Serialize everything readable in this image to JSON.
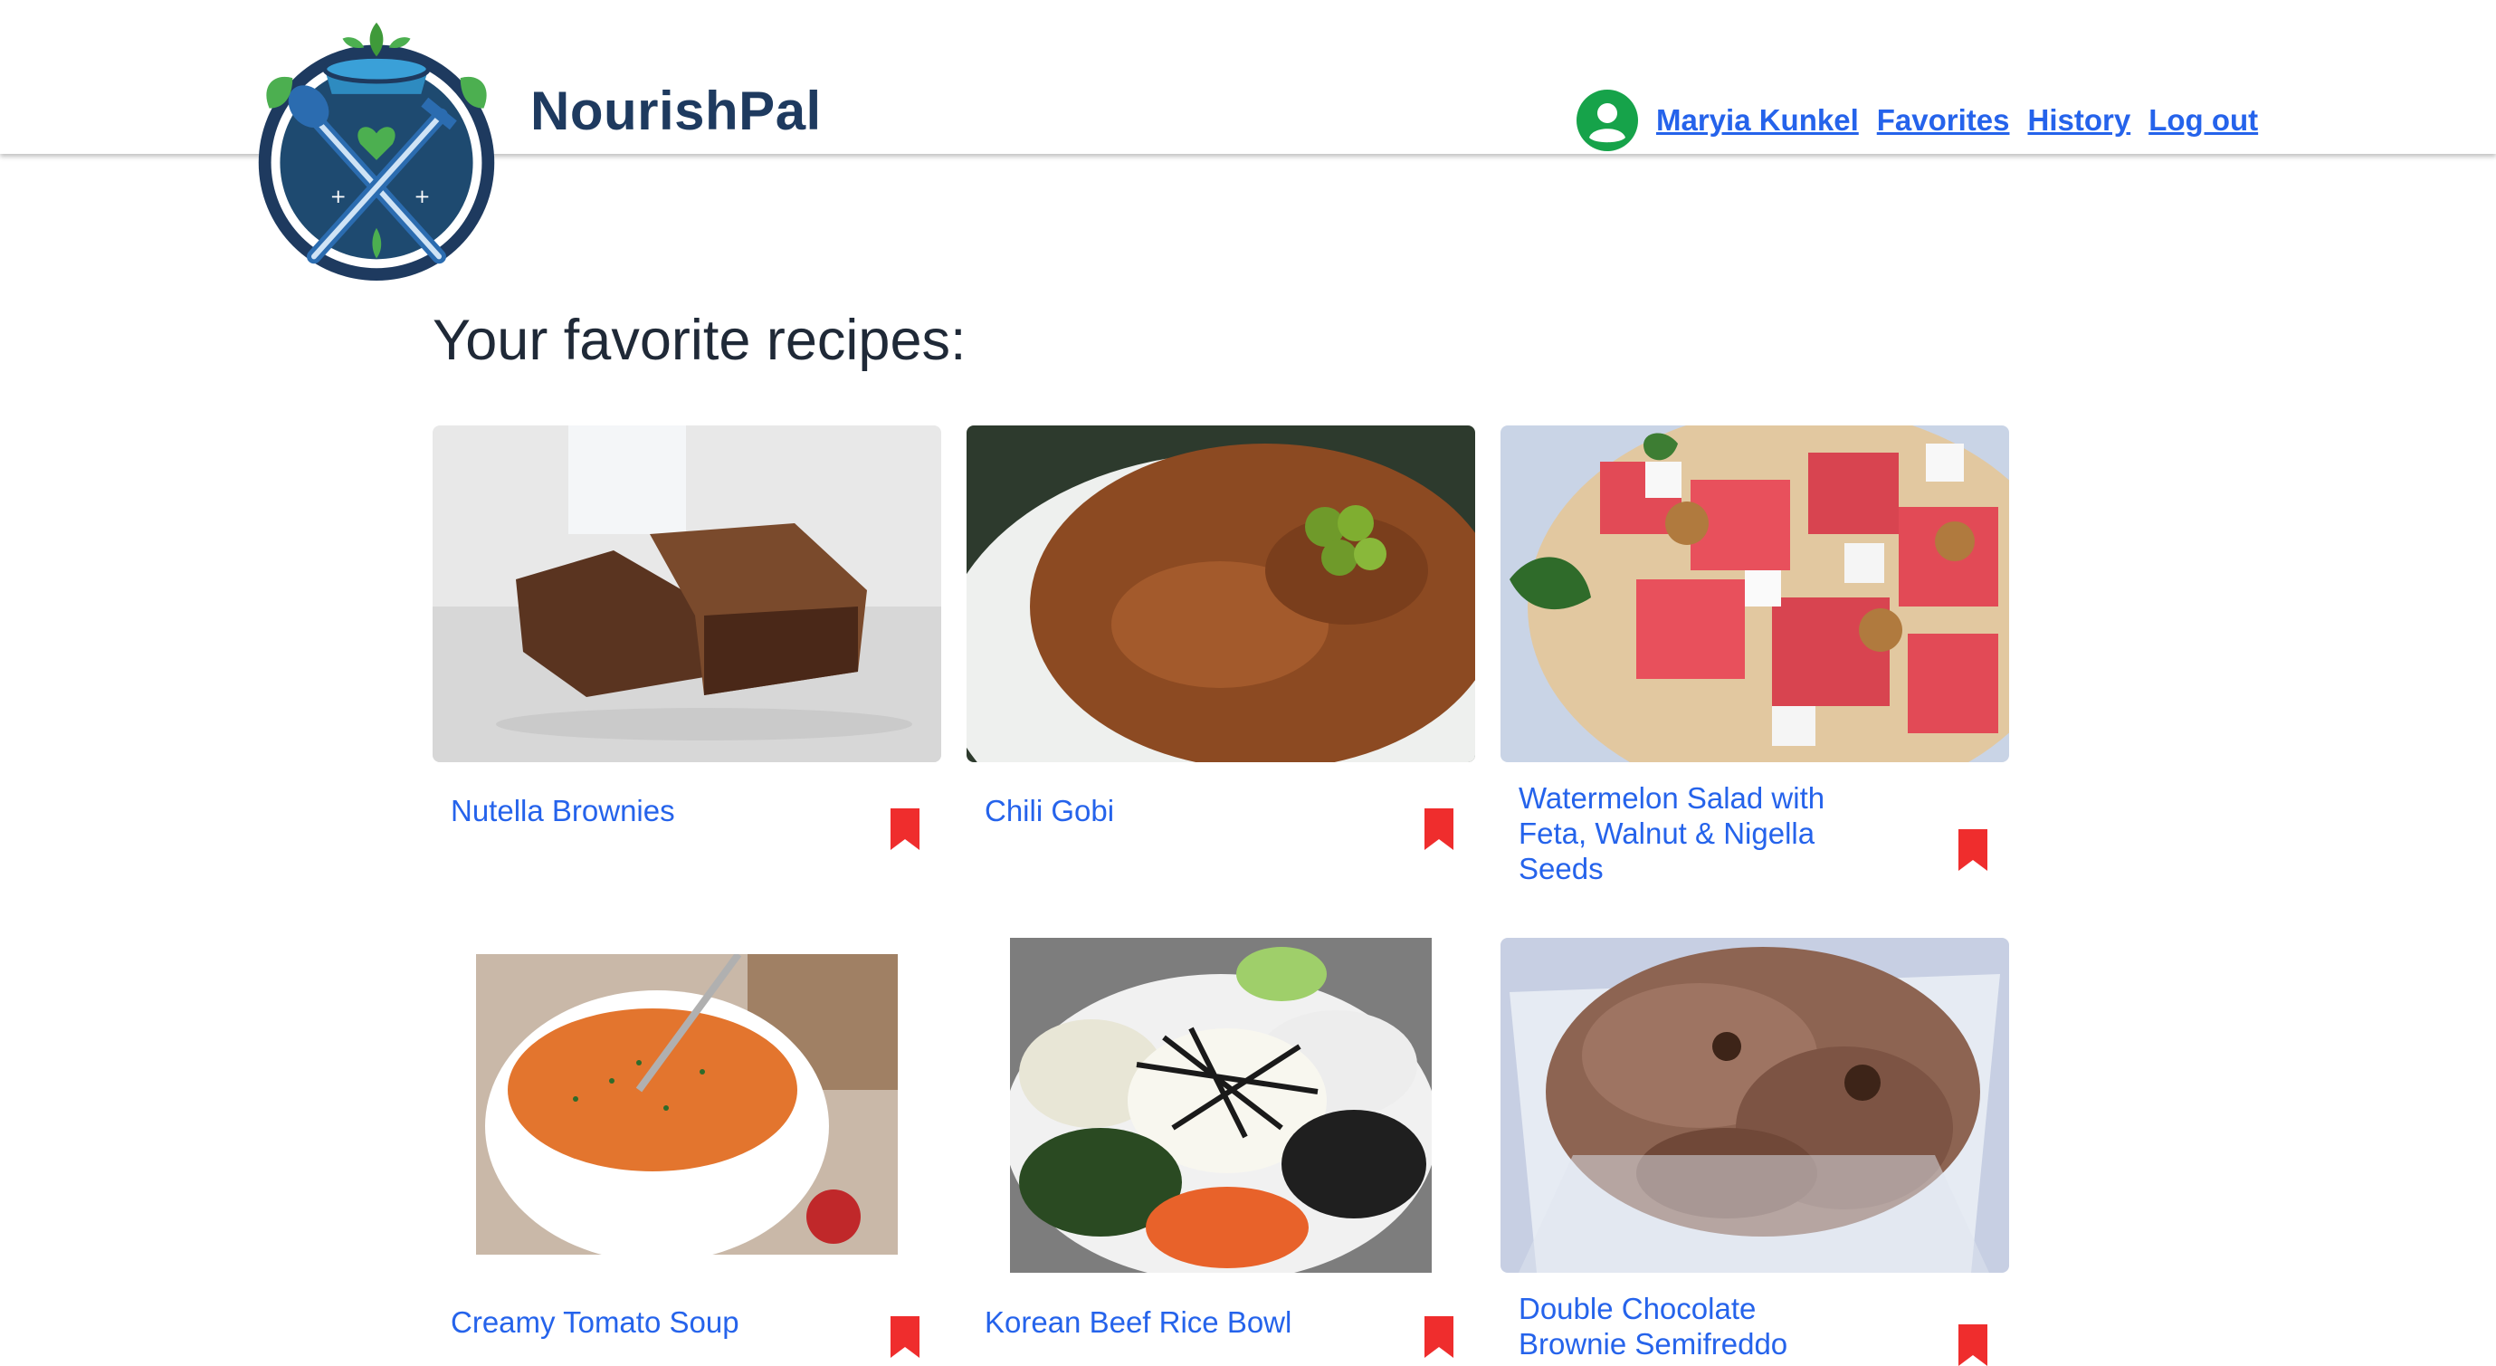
{
  "header": {
    "brand": "NourishPal",
    "nav": {
      "user": "Maryia Kunkel",
      "favorites": "Favorites",
      "history": "History",
      "logout": "Log out"
    }
  },
  "main": {
    "title": "Your favorite recipes:",
    "recipes": [
      {
        "title": "Nutella Brownies",
        "favorited": true
      },
      {
        "title": "Chili Gobi",
        "favorited": true
      },
      {
        "title": "Watermelon Salad with Feta, Walnut & Nigella Seeds",
        "favorited": true
      },
      {
        "title": "Creamy Tomato Soup",
        "favorited": true
      },
      {
        "title": "Korean Beef Rice Bowl",
        "favorited": true
      },
      {
        "title": "Double Chocolate Brownie Semifreddo",
        "favorited": true
      }
    ]
  },
  "colors": {
    "link": "#2563eb",
    "brand": "#1e3a5f",
    "bookmark": "#ef2d2d",
    "avatar": "#16a34a"
  },
  "icons": {
    "avatar": "user-circle-icon",
    "bookmark": "bookmark-icon"
  }
}
